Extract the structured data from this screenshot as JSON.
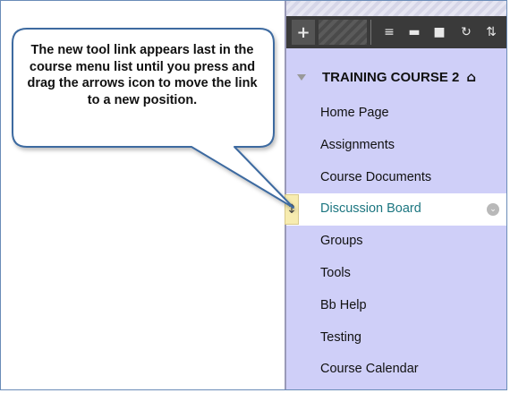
{
  "callout": {
    "text": "The new tool link appears last in the course menu list until you press and drag the arrows icon to move the link to a new position."
  },
  "toolbar": {
    "add_icon": "plus-icon",
    "icons": [
      "list-icon",
      "folder-icon",
      "panel-icon",
      "refresh-icon",
      "sort-icon"
    ],
    "plus_glyph": "+",
    "list_glyph": "≡",
    "folder_glyph": "▬",
    "panel_glyph": "■",
    "refresh_glyph": "↻",
    "sort_glyph": "⇅"
  },
  "course": {
    "title": "TRAINING COURSE 2",
    "home_glyph": "⌂"
  },
  "menu": {
    "items": [
      {
        "label": "Home Page"
      },
      {
        "label": "Assignments"
      },
      {
        "label": "Course Documents"
      },
      {
        "label": "Discussion Board"
      },
      {
        "label": "Groups"
      },
      {
        "label": "Tools"
      },
      {
        "label": "Bb Help"
      },
      {
        "label": "Testing"
      },
      {
        "label": "Course Calendar"
      }
    ],
    "active_index": 3,
    "drag_glyph": "↕",
    "chevron_glyph": "⌄"
  },
  "colors": {
    "panel": "#cfcff8",
    "toolbar": "#3a3a3a",
    "active_text": "#1c7680",
    "callout_fill": "#ffffff",
    "callout_border": "#3d6aa0"
  }
}
